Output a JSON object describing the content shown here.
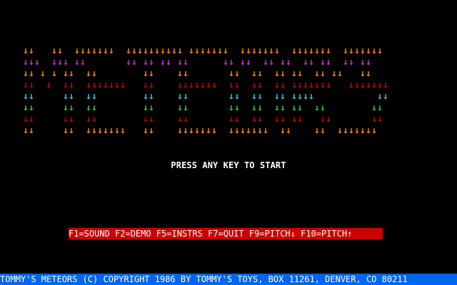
{
  "title_logo": {
    "text": "METEORS",
    "glyph": "↓",
    "row_colors": [
      "#ff8800",
      "#cc33cc",
      "#ff8800",
      "#cc0000",
      "#33cccc",
      "#33cc33",
      "#cc0000",
      "#ff8800"
    ],
    "rows": [
      "##   ##  #######  ########## #######  #######  #######  #######  ",
      "###  ### ##       ## ## ## ##      ## ##  ## ##  ## ##  ## ##    ",
      "## # # ##  ##        ##    ##       ##  ##  ## ##  ## ##   ##    ",
      "##  #  ##  #######   ##    #######  ##  ##  ## #######   ####### ",
      "##     ##  ##        ##    ##       ##  ##  ## ####           ## ",
      "##     ##  ##        ##    ##       ##  ##  ## ##  ##        ##  ",
      "##     ##  ##        ##    ##       ##  ##  ## ##   ##       ##  ",
      "##     ##  #######   ##    #######  #######  ##    ##  #######  "
    ]
  },
  "start_prompt": "PRESS ANY KEY TO START",
  "function_keys": "F1=SOUND F2=DEMO F5=INSTRS F7=QUIT F9=PITCH↓ F10=PITCH↑",
  "copyright": "TOMMY'S METEORS (C) COPYRIGHT 1986 BY TOMMY'S TOYS, BOX 11261, DENVER, CO 80211",
  "colors": {
    "background": "#000000",
    "function_bar": "#cc0000",
    "copyright_bar": "#0066ee",
    "text": "#ffffff"
  }
}
